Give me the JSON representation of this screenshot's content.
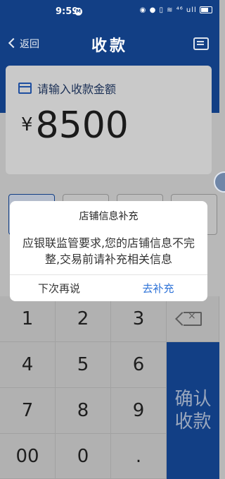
{
  "status_bar": {
    "time": "9:59",
    "notification_badge": "M",
    "icons": "◉ ● ▯ ≋ ⁴⁶ ull"
  },
  "header": {
    "back_label": "返回",
    "title": "收款"
  },
  "amount_card": {
    "placeholder": "请输入收款金额",
    "currency_symbol": "¥",
    "amount": "8500"
  },
  "keypad": {
    "keys": [
      "1",
      "2",
      "3",
      "4",
      "5",
      "6",
      "7",
      "8",
      "9",
      "00",
      "0",
      "."
    ],
    "confirm_label": "确认收款"
  },
  "dialog": {
    "title": "店铺信息补充",
    "message": "应银联监管要求,您的店铺信息不完整,交易前请补充相关信息",
    "cancel_label": "下次再说",
    "confirm_label": "去补充"
  },
  "colors": {
    "brand_blue": "#123f85",
    "link_blue": "#2e73d8"
  }
}
